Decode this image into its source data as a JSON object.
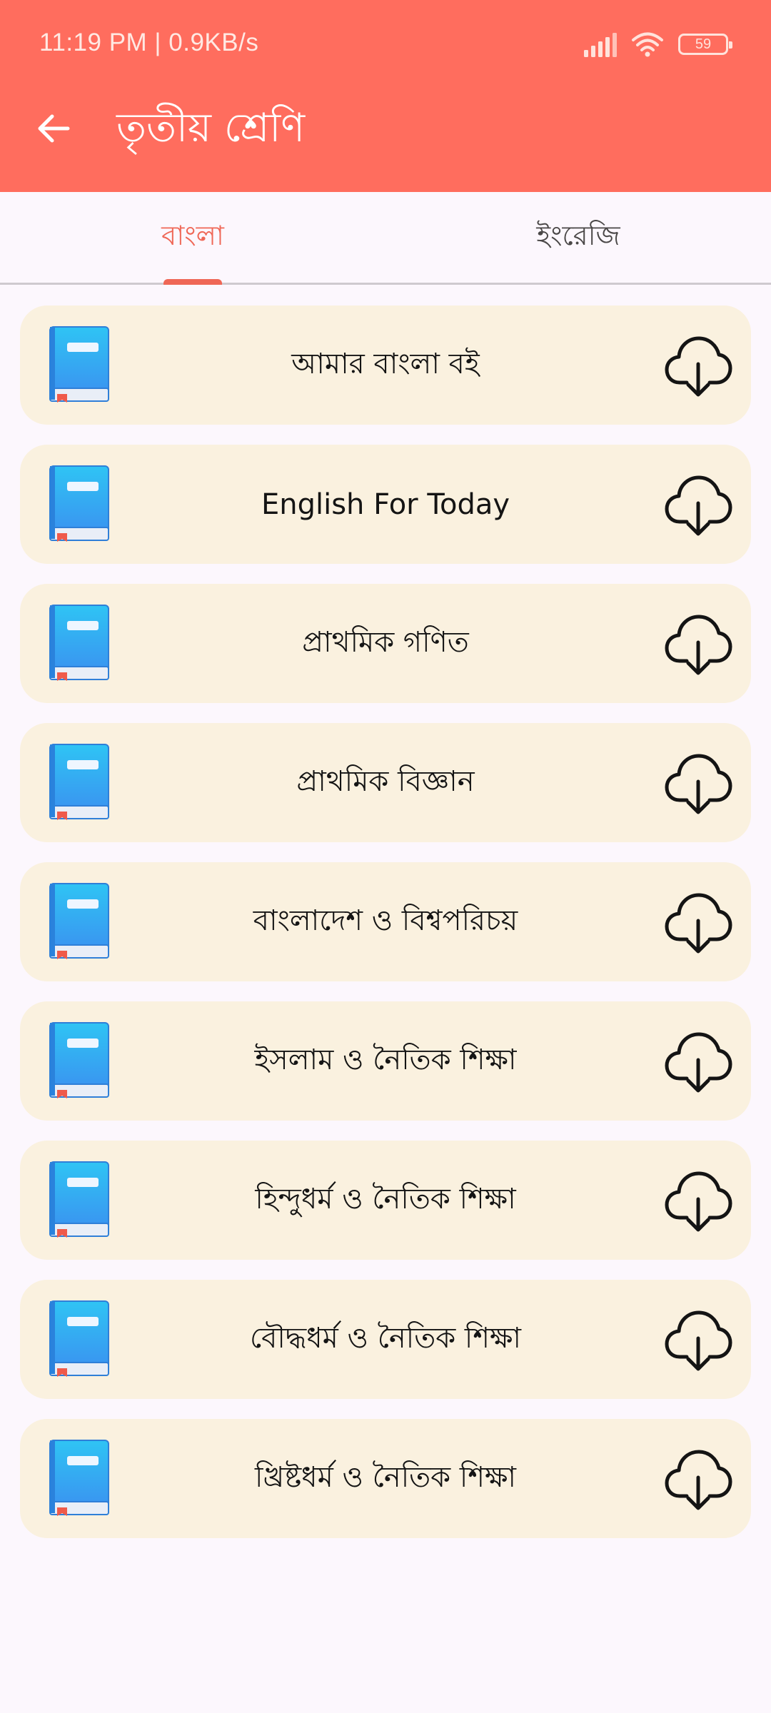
{
  "status_bar": {
    "time_speed": "11:19 PM | 0.9KB/s",
    "battery": "59",
    "signal_icon": "signal-bars-icon",
    "wifi_icon": "wifi-icon"
  },
  "app_bar": {
    "title": "তৃতীয় শ্রেণি",
    "back_icon": "arrow-left-icon",
    "background_color": "#ff6d5e"
  },
  "tabs": [
    {
      "label": "বাংলা",
      "active": true
    },
    {
      "label": "ইংরেজি",
      "active": false
    }
  ],
  "accent_color": "#ef6756",
  "card_color": "#faf1df",
  "books": [
    {
      "title": "আমার বাংলা বই",
      "icon": "book-icon",
      "action_icon": "cloud-download-icon"
    },
    {
      "title": "English For Today",
      "icon": "book-icon",
      "action_icon": "cloud-download-icon"
    },
    {
      "title": "প্রাথমিক গণিত",
      "icon": "book-icon",
      "action_icon": "cloud-download-icon"
    },
    {
      "title": "প্রাথমিক বিজ্ঞান",
      "icon": "book-icon",
      "action_icon": "cloud-download-icon"
    },
    {
      "title": "বাংলাদেশ ও বিশ্বপরিচয়",
      "icon": "book-icon",
      "action_icon": "cloud-download-icon"
    },
    {
      "title": "ইসলাম ও নৈতিক শিক্ষা",
      "icon": "book-icon",
      "action_icon": "cloud-download-icon"
    },
    {
      "title": "হিন্দুধর্ম ও নৈতিক শিক্ষা",
      "icon": "book-icon",
      "action_icon": "cloud-download-icon"
    },
    {
      "title": "বৌদ্ধধর্ম ও নৈতিক শিক্ষা",
      "icon": "book-icon",
      "action_icon": "cloud-download-icon"
    },
    {
      "title": "খ্রিষ্টধর্ম ও নৈতিক শিক্ষা",
      "icon": "book-icon",
      "action_icon": "cloud-download-icon"
    }
  ]
}
